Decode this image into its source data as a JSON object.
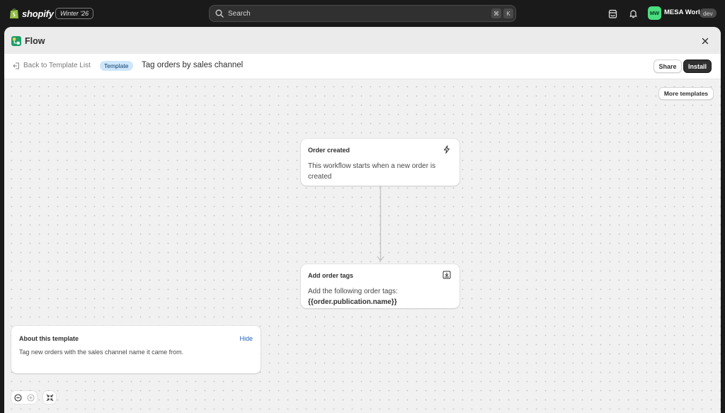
{
  "topbar": {
    "logo_text": "shopify",
    "edition": "Winter '26",
    "search_placeholder": "Search",
    "shortcut_cmd": "⌘",
    "shortcut_key": "K",
    "avatar_initials": "MW",
    "store_name": "MESA World",
    "store_badge": "dev"
  },
  "app": {
    "title": "Flow",
    "back_label": "Back to Template List",
    "badge": "Template",
    "template_name": "Tag orders by sales channel",
    "share_label": "Share",
    "install_label": "Install",
    "more_templates_label": "More templates"
  },
  "workflow": {
    "trigger": {
      "title": "Order created",
      "description": "This workflow starts when a new order is created",
      "icon": "lightning-icon"
    },
    "action": {
      "title": "Add order tags",
      "description": "Add the following order tags:",
      "value": "{{order.publication.name}}",
      "icon": "download-box-icon"
    }
  },
  "about": {
    "title": "About this template",
    "hide_label": "Hide",
    "text": "Tag new orders with the sales channel name it came from."
  },
  "colors": {
    "topbar_bg": "#1a1a1a",
    "avatar_bg": "#4ade80",
    "badge_bg": "#cde6fb",
    "link": "#2463bc",
    "primary_button": "#303030"
  }
}
